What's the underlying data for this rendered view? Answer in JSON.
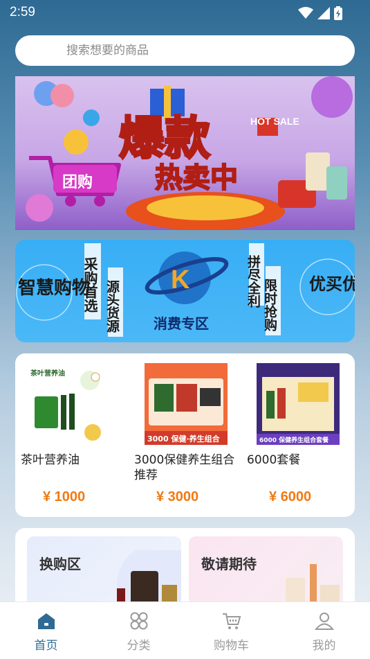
{
  "status_bar": {
    "time": "2:59"
  },
  "search": {
    "placeholder": "搜索想要的商品"
  },
  "banner_top": {
    "line1": "爆款",
    "line2": "热卖中",
    "badge": "HOT SALE",
    "cart_label": "团购"
  },
  "banner_mid": {
    "left_text": "智慧购物",
    "col1": "采购首选",
    "col2": "源头货源",
    "center_text": "消费专区",
    "col3": "拼尽全利",
    "col4": "限时抢购",
    "right_text": "优买优选"
  },
  "products": [
    {
      "name": "茶叶营养油",
      "price": "¥ 1000",
      "image_title": "茶叶营养油"
    },
    {
      "name": "3000保健养生组合推荐",
      "price": "¥ 3000",
      "image_title": "3000 保健·养生组合"
    },
    {
      "name": "6000套餐",
      "price": "¥ 6000",
      "image_title": "6000 保健养生组合套餐"
    }
  ],
  "promos": [
    {
      "title": "换购区"
    },
    {
      "title": "敬请期待"
    }
  ],
  "tabbar": {
    "items": [
      {
        "label": "首页",
        "icon": "home-icon",
        "active": true
      },
      {
        "label": "分类",
        "icon": "category-icon",
        "active": false
      },
      {
        "label": "购物车",
        "icon": "cart-icon",
        "active": false
      },
      {
        "label": "我的",
        "icon": "user-icon",
        "active": false
      }
    ]
  },
  "colors": {
    "accent": "#2e6a93",
    "price": "#f07a14",
    "banner_blue": "#38aef5"
  }
}
